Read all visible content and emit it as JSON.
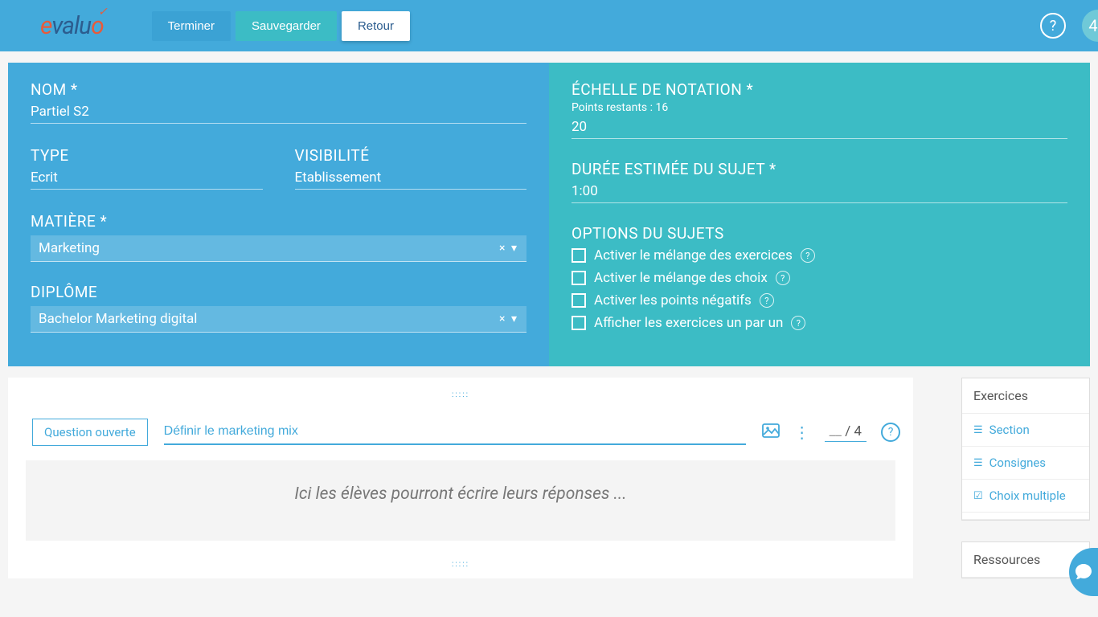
{
  "topbar": {
    "terminer": "Terminer",
    "sauvegarder": "Sauvegarder",
    "retour": "Retour"
  },
  "form": {
    "nom_label": "NOM *",
    "nom_value": "Partiel S2",
    "type_label": "TYPE",
    "type_value": "Ecrit",
    "visibilite_label": "VISIBILITÉ",
    "visibilite_value": "Etablissement",
    "matiere_label": "MATIÈRE *",
    "matiere_value": "Marketing",
    "diplome_label": "DIPLÔME",
    "diplome_value": "Bachelor Marketing digital",
    "echelle_label": "ÉCHELLE DE NOTATION *",
    "points_restants": "Points restants : 16",
    "echelle_value": "20",
    "duree_label": "DURÉE ESTIMÉE DU SUJET *",
    "duree_value": "1:00",
    "options_label": "OPTIONS DU SUJETS",
    "opt1": "Activer le mélange des exercices",
    "opt2": "Activer le mélange des choix",
    "opt3": "Activer les points négatifs",
    "opt4": "Afficher les exercices un par un"
  },
  "question": {
    "badge": "Question ouverte",
    "title": "Définir le marketing mix",
    "score_blank": "__",
    "score_denom": " / 4",
    "answer_placeholder": "Ici les élèves pourront écrire leurs réponses ..."
  },
  "sidepanel": {
    "exercices_title": "Exercices",
    "section": "Section",
    "consignes": "Consignes",
    "choix_multiple": "Choix multiple",
    "ressources_title": "Ressources"
  }
}
